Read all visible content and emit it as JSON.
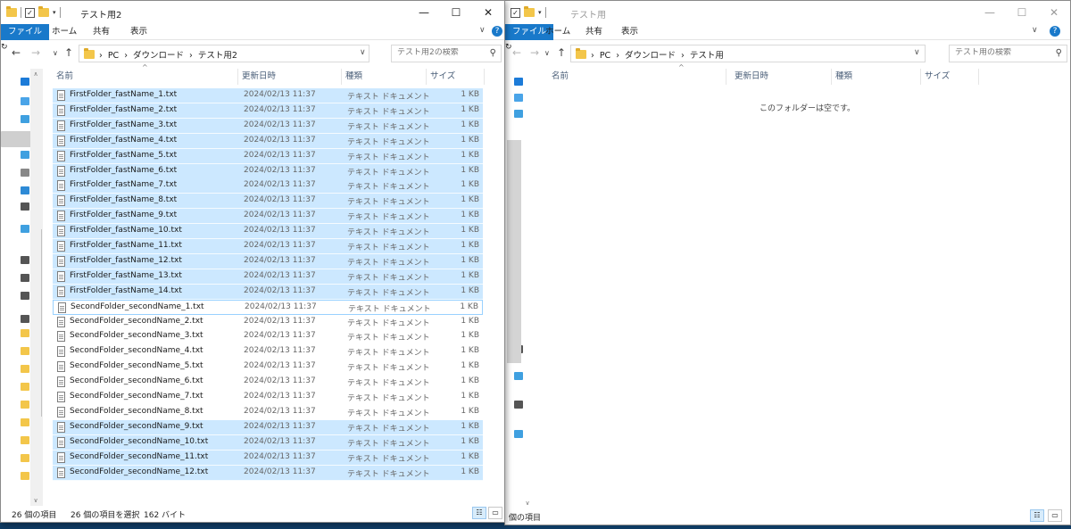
{
  "left_window": {
    "title": "テスト用2",
    "ribbon_tabs": [
      "ファイル",
      "ホーム",
      "共有",
      "表示"
    ],
    "breadcrumb": [
      "PC",
      "ダウンロード",
      "テスト用2"
    ],
    "search_placeholder": "テスト用2の検索",
    "columns": [
      "名前",
      "更新日時",
      "種類",
      "サイズ"
    ],
    "files": [
      {
        "name": "FirstFolder_fastName_1.txt",
        "date": "2024/02/13 11:37",
        "type": "テキスト ドキュメント",
        "size": "1 KB",
        "selected": true
      },
      {
        "name": "FirstFolder_fastName_2.txt",
        "date": "2024/02/13 11:37",
        "type": "テキスト ドキュメント",
        "size": "1 KB",
        "selected": true
      },
      {
        "name": "FirstFolder_fastName_3.txt",
        "date": "2024/02/13 11:37",
        "type": "テキスト ドキュメント",
        "size": "1 KB",
        "selected": true
      },
      {
        "name": "FirstFolder_fastName_4.txt",
        "date": "2024/02/13 11:37",
        "type": "テキスト ドキュメント",
        "size": "1 KB",
        "selected": true
      },
      {
        "name": "FirstFolder_fastName_5.txt",
        "date": "2024/02/13 11:37",
        "type": "テキスト ドキュメント",
        "size": "1 KB",
        "selected": true
      },
      {
        "name": "FirstFolder_fastName_6.txt",
        "date": "2024/02/13 11:37",
        "type": "テキスト ドキュメント",
        "size": "1 KB",
        "selected": true
      },
      {
        "name": "FirstFolder_fastName_7.txt",
        "date": "2024/02/13 11:37",
        "type": "テキスト ドキュメント",
        "size": "1 KB",
        "selected": true
      },
      {
        "name": "FirstFolder_fastName_8.txt",
        "date": "2024/02/13 11:37",
        "type": "テキスト ドキュメント",
        "size": "1 KB",
        "selected": true
      },
      {
        "name": "FirstFolder_fastName_9.txt",
        "date": "2024/02/13 11:37",
        "type": "テキスト ドキュメント",
        "size": "1 KB",
        "selected": true
      },
      {
        "name": "FirstFolder_fastName_10.txt",
        "date": "2024/02/13 11:37",
        "type": "テキスト ドキュメント",
        "size": "1 KB",
        "selected": true
      },
      {
        "name": "FirstFolder_fastName_11.txt",
        "date": "2024/02/13 11:37",
        "type": "テキスト ドキュメント",
        "size": "1 KB",
        "selected": true
      },
      {
        "name": "FirstFolder_fastName_12.txt",
        "date": "2024/02/13 11:37",
        "type": "テキスト ドキュメント",
        "size": "1 KB",
        "selected": true
      },
      {
        "name": "FirstFolder_fastName_13.txt",
        "date": "2024/02/13 11:37",
        "type": "テキスト ドキュメント",
        "size": "1 KB",
        "selected": true
      },
      {
        "name": "FirstFolder_fastName_14.txt",
        "date": "2024/02/13 11:37",
        "type": "テキスト ドキュメント",
        "size": "1 KB",
        "selected": true
      },
      {
        "name": "SecondFolder_secondName_1.txt",
        "date": "2024/02/13 11:37",
        "type": "テキスト ドキュメント",
        "size": "1 KB",
        "selected": false,
        "focused": true
      },
      {
        "name": "SecondFolder_secondName_2.txt",
        "date": "2024/02/13 11:37",
        "type": "テキスト ドキュメント",
        "size": "1 KB",
        "selected": false
      },
      {
        "name": "SecondFolder_secondName_3.txt",
        "date": "2024/02/13 11:37",
        "type": "テキスト ドキュメント",
        "size": "1 KB",
        "selected": false
      },
      {
        "name": "SecondFolder_secondName_4.txt",
        "date": "2024/02/13 11:37",
        "type": "テキスト ドキュメント",
        "size": "1 KB",
        "selected": false
      },
      {
        "name": "SecondFolder_secondName_5.txt",
        "date": "2024/02/13 11:37",
        "type": "テキスト ドキュメント",
        "size": "1 KB",
        "selected": false
      },
      {
        "name": "SecondFolder_secondName_6.txt",
        "date": "2024/02/13 11:37",
        "type": "テキスト ドキュメント",
        "size": "1 KB",
        "selected": false
      },
      {
        "name": "SecondFolder_secondName_7.txt",
        "date": "2024/02/13 11:37",
        "type": "テキスト ドキュメント",
        "size": "1 KB",
        "selected": false
      },
      {
        "name": "SecondFolder_secondName_8.txt",
        "date": "2024/02/13 11:37",
        "type": "テキスト ドキュメント",
        "size": "1 KB",
        "selected": false
      },
      {
        "name": "SecondFolder_secondName_9.txt",
        "date": "2024/02/13 11:37",
        "type": "テキスト ドキュメント",
        "size": "1 KB",
        "selected": true
      },
      {
        "name": "SecondFolder_secondName_10.txt",
        "date": "2024/02/13 11:37",
        "type": "テキスト ドキュメント",
        "size": "1 KB",
        "selected": true
      },
      {
        "name": "SecondFolder_secondName_11.txt",
        "date": "2024/02/13 11:37",
        "type": "テキスト ドキュメント",
        "size": "1 KB",
        "selected": true
      },
      {
        "name": "SecondFolder_secondName_12.txt",
        "date": "2024/02/13 11:37",
        "type": "テキスト ドキュメント",
        "size": "1 KB",
        "selected": true
      }
    ],
    "status": {
      "item_count": "26 個の項目",
      "selection": "26 個の項目を選択",
      "selection_size": "162 バイト"
    }
  },
  "right_window": {
    "title": "テスト用",
    "ribbon_tabs": [
      "ファイル",
      "ホーム",
      "共有",
      "表示"
    ],
    "breadcrumb": [
      "PC",
      "ダウンロード",
      "テスト用"
    ],
    "search_placeholder": "テスト用の検索",
    "columns": [
      "名前",
      "更新日時",
      "種類",
      "サイズ"
    ],
    "empty_message": "このフォルダーは空です。",
    "status": {
      "item_count": "個の項目"
    }
  },
  "colors": {
    "selection": "#cce8ff",
    "file_tab": "#1979ca"
  }
}
